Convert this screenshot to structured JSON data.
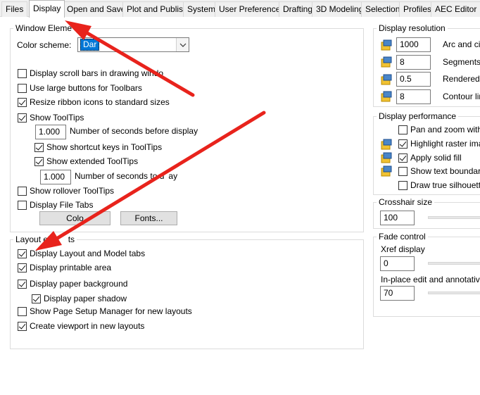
{
  "tabs": [
    "Files",
    "Display",
    "Open and Save",
    "Plot and Publish",
    "System",
    "User Preferences",
    "Drafting",
    "3D Modeling",
    "Selection",
    "Profiles",
    "AEC Editor"
  ],
  "window_elements": {
    "legend": "Window Eleme",
    "color_scheme_label": "Color scheme:",
    "color_scheme_value": "Dar",
    "scroll_bars": "Display scroll bars in drawing windo",
    "large_buttons": "Use large buttons for Toolbars",
    "resize_ribbon": "Resize ribbon icons to standard sizes",
    "show_tooltips": "Show ToolTips",
    "seconds_before_value": "1.000",
    "seconds_before_label": "Number of seconds before display",
    "shortcut_keys": "Show shortcut keys in ToolTips",
    "extended_tooltips": "Show extended ToolTips",
    "seconds_delay_value": "1.000",
    "seconds_delay_label": "Number of seconds to d",
    "seconds_delay_tail": "ay",
    "rollover_tooltips": "Show rollover ToolTips",
    "file_tabs": "Display File Tabs",
    "colors_button": "Colo",
    "fonts_button": "Fonts..."
  },
  "layout_elements": {
    "legend_left": "Layout el",
    "legend_right": "ts",
    "layout_model_tabs": "Display Layout and Model tabs",
    "printable_area": "Display printable area",
    "paper_background": "Display paper background",
    "paper_shadow": "Display paper shadow",
    "page_setup_manager": "Show Page Setup Manager for new layouts",
    "create_viewport": "Create viewport in new layouts"
  },
  "display_resolution": {
    "legend": "Display resolution",
    "arc_value": "1000",
    "arc_label": "Arc and circ",
    "segments_value": "8",
    "segments_label": "Segments ir",
    "rendered_value": "0.5",
    "rendered_label": "Rendered o",
    "contour_value": "8",
    "contour_label": "Contour line"
  },
  "display_performance": {
    "legend": "Display performance",
    "pan_zoom": "Pan and zoom with ra",
    "highlight_raster": "Highlight raster image",
    "apply_solid_fill": "Apply solid fill",
    "text_boundary": "Show text boundary fr",
    "true_silhouettes": "Draw true silhouettes"
  },
  "crosshair": {
    "legend": "Crosshair size",
    "value": "100"
  },
  "fade_control": {
    "legend": "Fade control",
    "xref_label": "Xref display",
    "xref_value": "0",
    "inplace_label": "In-place edit and annotative re",
    "inplace_value": "70"
  },
  "checkbox_states": {
    "scroll_bars": false,
    "large_buttons": false,
    "resize_ribbon": true,
    "show_tooltips": true,
    "shortcut_keys": true,
    "extended_tooltips": true,
    "rollover_tooltips": false,
    "file_tabs": false,
    "layout_model_tabs": true,
    "printable_area": true,
    "paper_background": true,
    "paper_shadow": true,
    "page_setup_manager": false,
    "create_viewport": true,
    "pan_zoom": false,
    "highlight_raster": true,
    "apply_solid_fill": true,
    "text_boundary": false,
    "true_silhouettes": false
  },
  "colors": {
    "arrow": "#e8231c",
    "selection": "#0078d7",
    "group_border": "#dcdcdc"
  }
}
